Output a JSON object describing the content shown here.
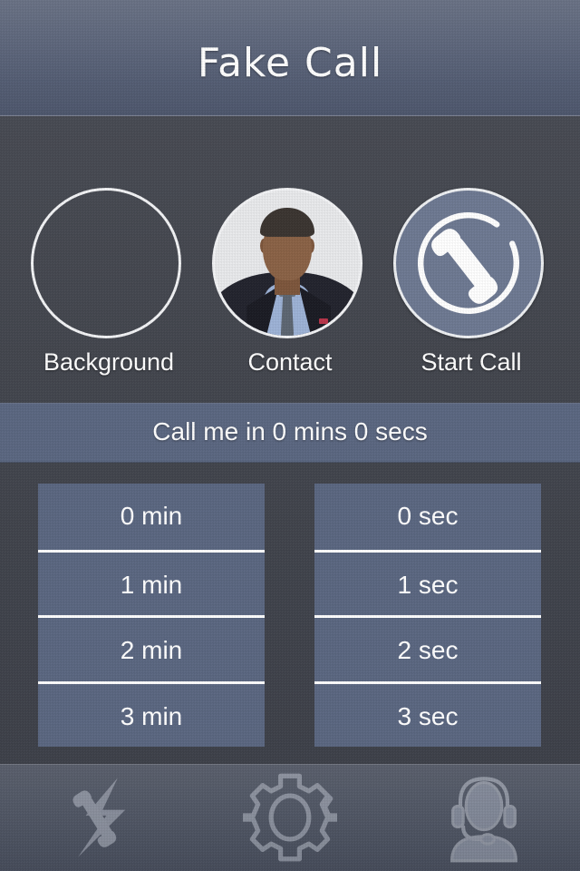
{
  "app": {
    "title": "Fake Call"
  },
  "actions": [
    {
      "id": "background",
      "label": "Background",
      "icon": "empty-circle-icon"
    },
    {
      "id": "contact",
      "label": "Contact",
      "icon": "contact-photo"
    },
    {
      "id": "start_call",
      "label": "Start Call",
      "icon": "phone-handset-icon"
    }
  ],
  "status": {
    "text": "Call me in 0 mins 0 secs",
    "minutes": 0,
    "seconds": 0
  },
  "pickers": {
    "minutes": {
      "name": "minutes-picker",
      "selected": "0 min",
      "options": [
        "0 min",
        "1 min",
        "2 min",
        "3 min"
      ]
    },
    "seconds": {
      "name": "seconds-picker",
      "selected": "0 sec",
      "options": [
        "0 sec",
        "1 sec",
        "2 sec",
        "3 sec"
      ]
    }
  },
  "toolbar": [
    {
      "id": "instant_call",
      "icon": "phone-lightning-icon"
    },
    {
      "id": "settings",
      "icon": "gear-icon"
    },
    {
      "id": "support",
      "icon": "headset-person-icon"
    }
  ],
  "colors": {
    "header_top": "#6a7285",
    "header_bottom": "#4e576d",
    "body": "#43464e",
    "accent_panel": "#5b6781",
    "call_button_fill": "#6e7992",
    "text": "#ffffff",
    "separator": "#ffffff",
    "toolbar": "#4c5260"
  }
}
